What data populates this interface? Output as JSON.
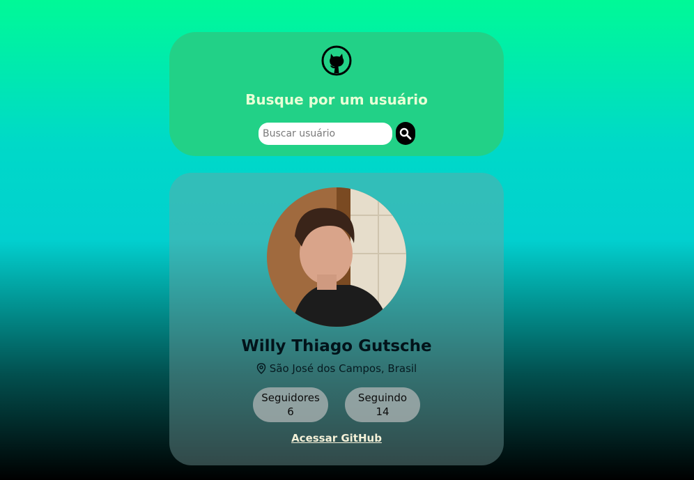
{
  "search": {
    "logo_icon": "github-icon",
    "title": "Busque por um usuário",
    "input_value": "",
    "placeholder": "Buscar usuário",
    "button_icon": "search-icon"
  },
  "profile": {
    "avatar": "user-photo",
    "name": "Willy Thiago Gutsche",
    "location_icon": "location-pin-icon",
    "location": "São José dos Campos, Brasil",
    "followers_label": "Seguidores",
    "followers_count": "6",
    "following_label": "Seguindo",
    "following_count": "14",
    "link_label": "Acessar GitHub"
  },
  "colors": {
    "search_card": "#22d187",
    "title_text": "#e8ffd6",
    "search_button": "#000000",
    "link_text": "#f4f1d8"
  }
}
